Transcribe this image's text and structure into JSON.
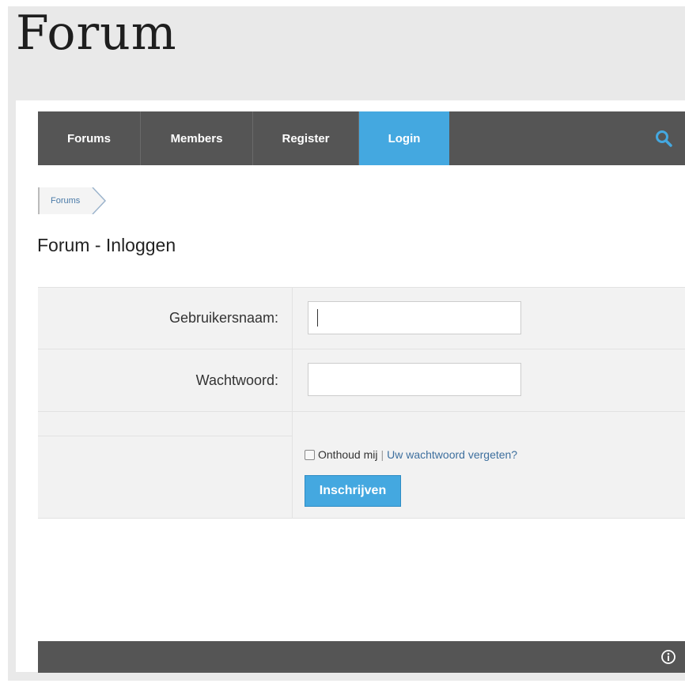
{
  "header": {
    "site_title": "Forum"
  },
  "nav": {
    "items": [
      {
        "label": "Forums"
      },
      {
        "label": "Members"
      },
      {
        "label": "Register"
      },
      {
        "label": "Login"
      }
    ],
    "search_icon": "search-icon"
  },
  "breadcrumb": {
    "items": [
      "Forums"
    ]
  },
  "page": {
    "title": "Forum - Inloggen"
  },
  "login_form": {
    "username_label": "Gebruikersnaam:",
    "username_value": "",
    "password_label": "Wachtwoord:",
    "password_value": "",
    "remember_label": "Onthoud mij",
    "separator": "|",
    "forgot_link": "Uw wachtwoord vergeten?",
    "submit_label": "Inschrijven"
  },
  "footer": {
    "info_icon": "info-icon"
  },
  "colors": {
    "nav_bg": "#555555",
    "accent": "#44a8e0",
    "link": "#3d6f9e"
  }
}
